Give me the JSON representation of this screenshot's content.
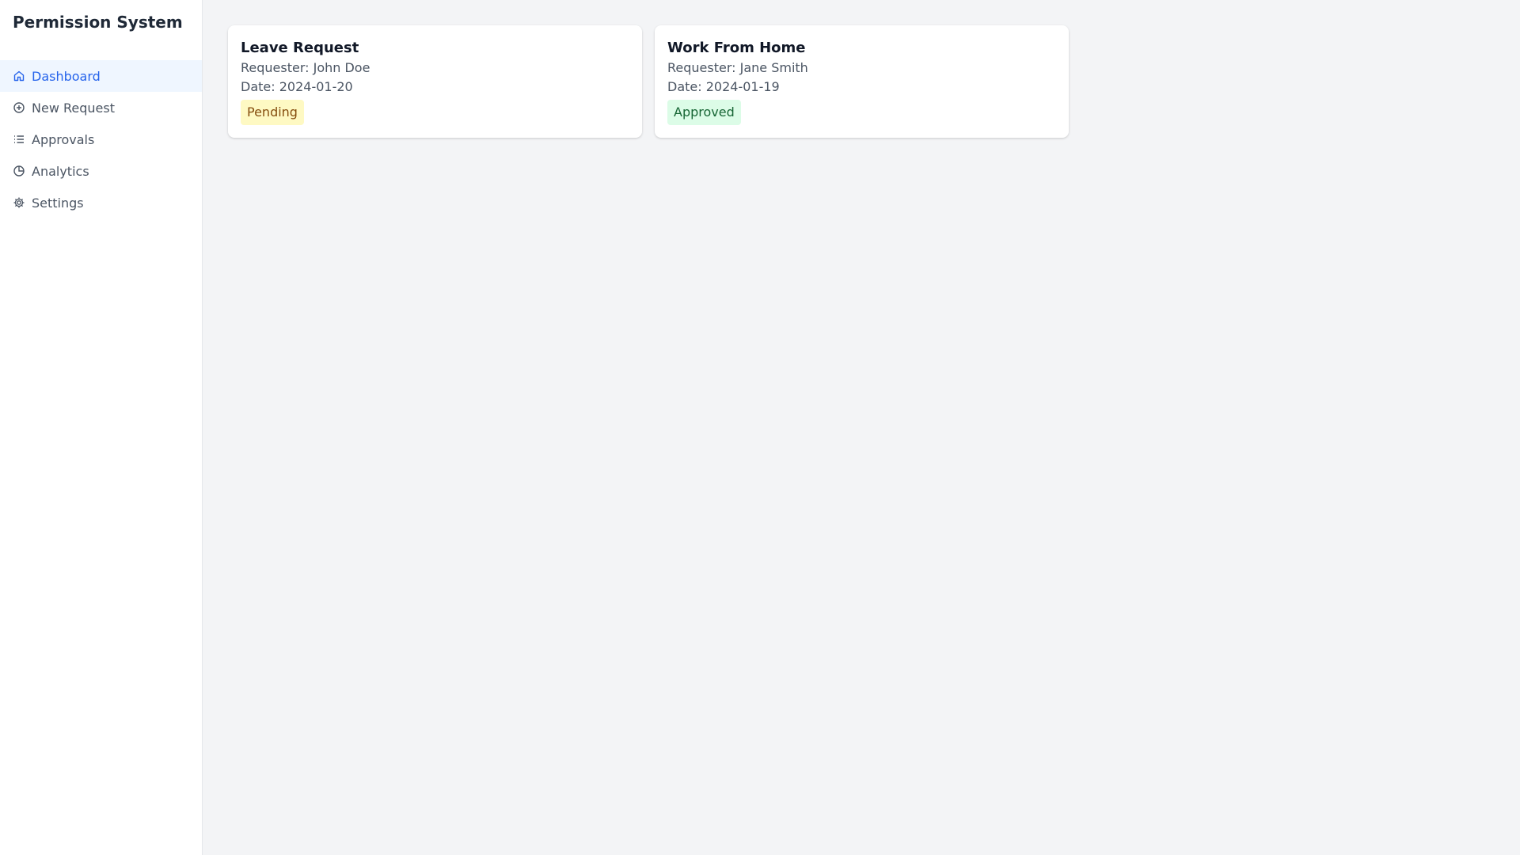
{
  "app": {
    "title": "Permission System"
  },
  "sidebar": {
    "items": [
      {
        "label": "Dashboard",
        "icon": "home-icon",
        "active": true
      },
      {
        "label": "New Request",
        "icon": "plus-circle-icon",
        "active": false
      },
      {
        "label": "Approvals",
        "icon": "list-icon",
        "active": false
      },
      {
        "label": "Analytics",
        "icon": "pie-chart-icon",
        "active": false
      },
      {
        "label": "Settings",
        "icon": "gear-icon",
        "active": false
      }
    ]
  },
  "requests": [
    {
      "title": "Leave Request",
      "requester": "Requester: John Doe",
      "date": "Date: 2024-01-20",
      "status": "Pending"
    },
    {
      "title": "Work From Home",
      "requester": "Requester: Jane Smith",
      "date": "Date: 2024-01-19",
      "status": "Approved"
    }
  ],
  "colors": {
    "accent": "#2563eb",
    "pending_bg": "#fef9c3",
    "approved_bg": "#dcfce7"
  }
}
